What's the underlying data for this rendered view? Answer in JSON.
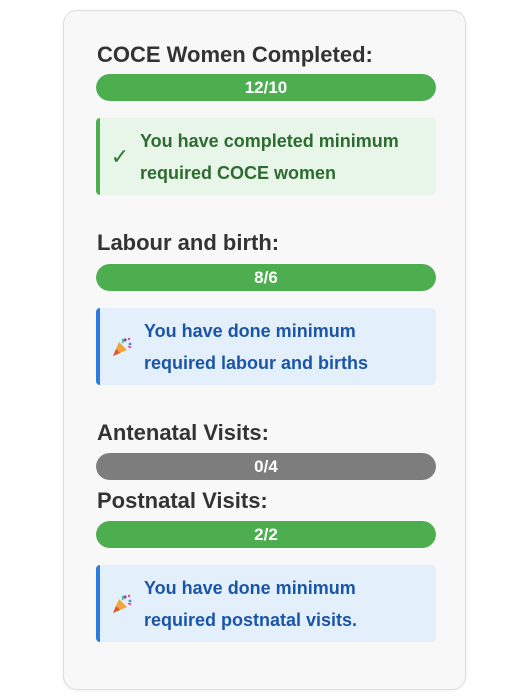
{
  "sections": [
    {
      "title": "COCE Women Completed:",
      "progress_text": "12/10",
      "progress_fraction": 1.0,
      "status": "complete",
      "alert": {
        "type": "success",
        "icon": "checkmark-icon",
        "text": "You have completed minimum required COCE women"
      }
    },
    {
      "title": "Labour and birth:",
      "progress_text": "8/6",
      "progress_fraction": 1.0,
      "status": "complete",
      "alert": {
        "type": "info",
        "icon": "party-popper-icon",
        "text": "You have done minimum required labour and births"
      }
    },
    {
      "title": "Antenatal Visits:",
      "progress_text": "0/4",
      "progress_fraction": 0.0,
      "status": "none"
    },
    {
      "title": "Postnatal Visits:",
      "progress_text": "2/2",
      "progress_fraction": 1.0,
      "status": "complete",
      "alert": {
        "type": "info",
        "icon": "party-popper-icon",
        "text": "You have done minimum required postnatal visits."
      }
    }
  ],
  "icons": {
    "checkmark": "✓"
  },
  "colors": {
    "complete_bar": "#4cae4f",
    "empty_bar": "#7d7d7d",
    "success_bg": "#e8f5e9",
    "info_bg": "#e3f0fb",
    "info_border": "#2d7be0",
    "success_text": "#2e6b30",
    "info_text": "#1b55a8"
  }
}
